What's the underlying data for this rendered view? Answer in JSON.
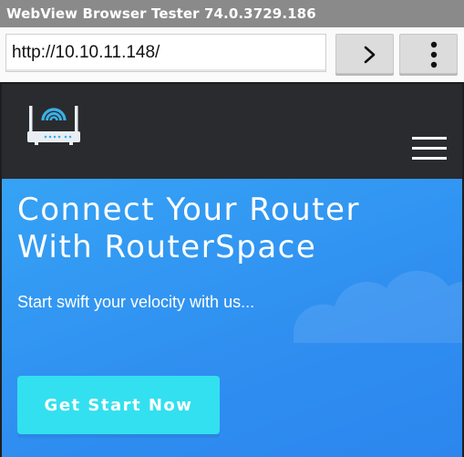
{
  "window": {
    "title": "WebView Browser Tester 74.0.3729.186"
  },
  "address_bar": {
    "url": "http://10.10.11.148/",
    "go_icon": "chevron-right-icon",
    "menu_icon": "more-vertical-icon"
  },
  "site": {
    "logo_icon": "router-icon",
    "menu_icon": "hamburger-menu-icon",
    "hero": {
      "headline_line1": "Connect Your Router",
      "headline_line2": "With RouterSpace",
      "subtitle": "Start swift your velocity with us...",
      "cta_label": "Get Start Now"
    }
  },
  "colors": {
    "titlebar": "#8a8a8a",
    "nav_bg": "#2a2b2e",
    "hero_blue": "#2f8ef0",
    "cta": "#33e0ef"
  }
}
